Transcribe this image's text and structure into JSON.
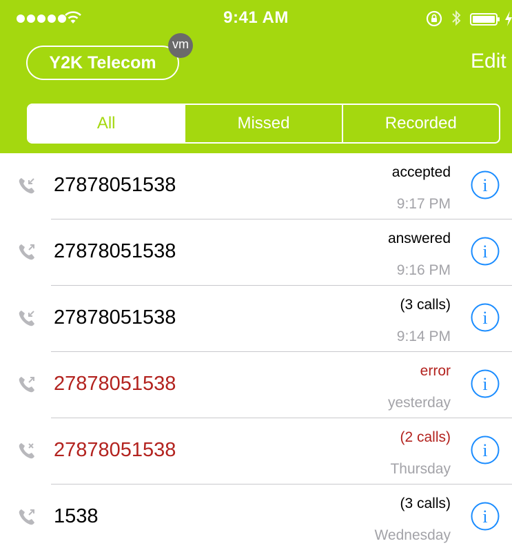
{
  "status_bar": {
    "time": "9:41 AM",
    "icons": [
      "signal-dots-icon",
      "wifi-icon",
      "rotation-lock-icon",
      "bluetooth-icon",
      "battery-icon",
      "charging-icon"
    ]
  },
  "header": {
    "carrier_label": "Y2K Telecom",
    "voicemail_badge": "vm",
    "edit_label": "Edit"
  },
  "filter_tabs": [
    {
      "label": "All",
      "active": true
    },
    {
      "label": "Missed",
      "active": false
    },
    {
      "label": "Recorded",
      "active": false
    }
  ],
  "calls": [
    {
      "number": "27878051538",
      "status": "accepted",
      "time": "9:17 PM",
      "type": "incoming",
      "missed": false
    },
    {
      "number": "27878051538",
      "status": "answered",
      "time": "9:16 PM",
      "type": "outgoing",
      "missed": false
    },
    {
      "number": "27878051538",
      "status": "(3 calls)",
      "time": "9:14 PM",
      "type": "incoming",
      "missed": false
    },
    {
      "number": "27878051538",
      "status": "error",
      "time": "yesterday",
      "type": "outgoing",
      "missed": true
    },
    {
      "number": "27878051538",
      "status": "(2 calls)",
      "time": "Thursday",
      "type": "missed",
      "missed": true
    },
    {
      "number": "1538",
      "status": "(3 calls)",
      "time": "Wednesday",
      "type": "outgoing",
      "missed": false
    }
  ],
  "colors": {
    "brand_green": "#a4d80f",
    "missed_red": "#b3231f",
    "info_blue": "#1a8cff",
    "secondary_gray": "#a3a3a8"
  }
}
